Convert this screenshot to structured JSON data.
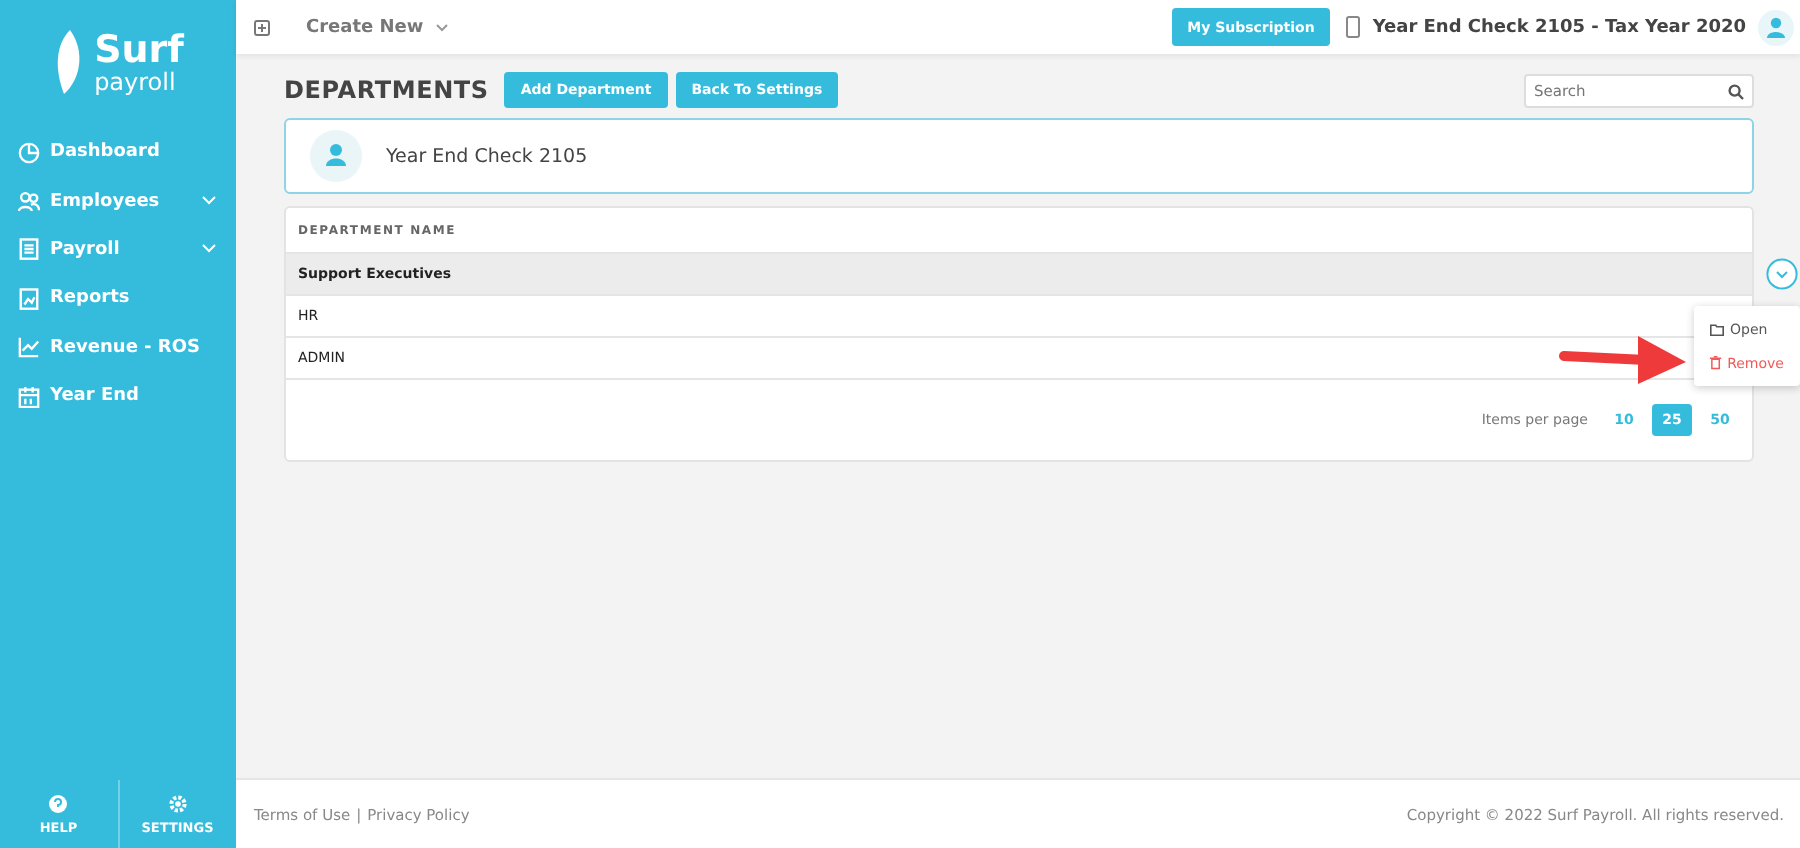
{
  "sidebar": {
    "logo": {
      "name": "Surf",
      "sub": "payroll"
    },
    "items": [
      {
        "label": "Dashboard",
        "expandable": false
      },
      {
        "label": "Employees",
        "expandable": true
      },
      {
        "label": "Payroll",
        "expandable": true
      },
      {
        "label": "Reports",
        "expandable": false
      },
      {
        "label": "Revenue - ROS",
        "expandable": false
      },
      {
        "label": "Year End",
        "expandable": false
      }
    ],
    "bottom": [
      {
        "label": "HELP"
      },
      {
        "label": "SETTINGS"
      }
    ]
  },
  "topbar": {
    "create": "Create New",
    "subscription": "My Subscription",
    "context": "Year End Check 2105 - Tax Year 2020"
  },
  "page": {
    "title": "DEPARTMENTS",
    "buttons": [
      "Add Department",
      "Back To Settings"
    ],
    "search": {
      "placeholder": "Search"
    }
  },
  "company": {
    "name": "Year End Check 2105"
  },
  "table": {
    "columns": [
      "DEPARTMENT NAME"
    ],
    "rows": [
      {
        "name": "Support Executives",
        "selected": true
      },
      {
        "name": "HR",
        "selected": false
      },
      {
        "name": "ADMIN",
        "selected": false
      }
    ]
  },
  "row_menu": {
    "items": [
      {
        "label": "Open",
        "kind": "normal"
      },
      {
        "label": "Remove",
        "kind": "danger"
      }
    ]
  },
  "pagination": {
    "label": "Items per page",
    "sizes": [
      {
        "label": "10",
        "selected": false
      },
      {
        "label": "25",
        "selected": true
      },
      {
        "label": "50",
        "selected": false
      }
    ]
  },
  "footer": {
    "links": [
      "Terms of Use",
      "Privacy Policy"
    ],
    "separator": "|",
    "copyright": "Copyright © 2022 Surf Payroll. All rights reserved."
  }
}
